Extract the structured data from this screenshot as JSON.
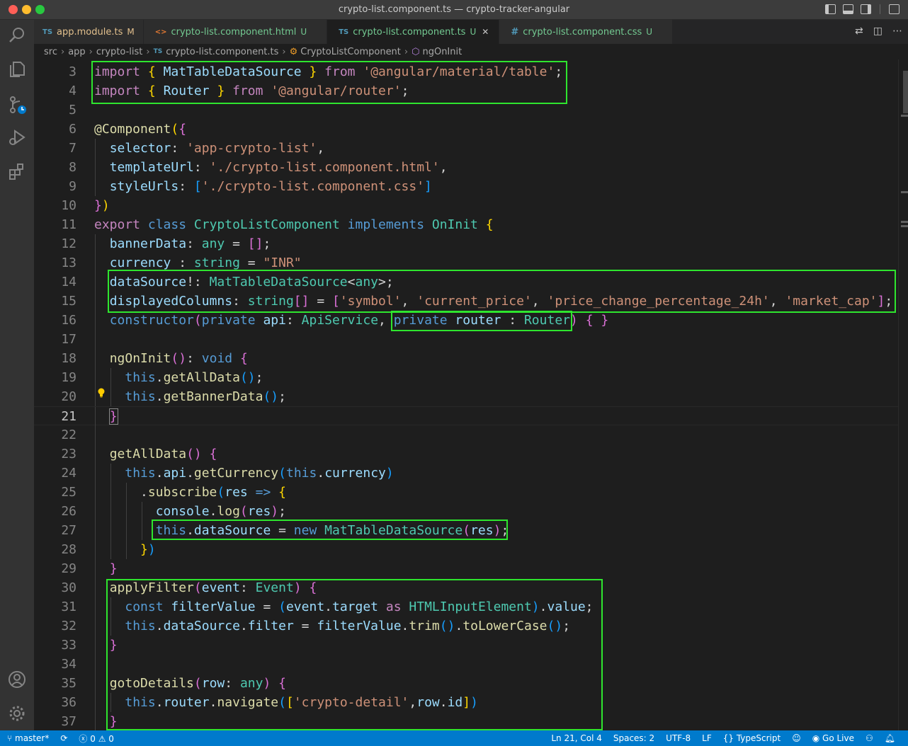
{
  "window": {
    "title": "crypto-list.component.ts — crypto-tracker-angular"
  },
  "activity_bar": [
    "files-icon",
    "search-icon",
    "source-control-icon",
    "run-debug-icon",
    "extensions-icon",
    "account-icon",
    "manage-gear-icon"
  ],
  "tabs": [
    {
      "badge": "TS",
      "label": "app.module.ts",
      "status": "M",
      "active": false
    },
    {
      "badge": "<>",
      "label": "crypto-list.component.html",
      "status": "U",
      "active": false
    },
    {
      "badge": "TS",
      "label": "crypto-list.component.ts",
      "status": "U",
      "active": true
    },
    {
      "badge": "#",
      "label": "crypto-list.component.css",
      "status": "U",
      "active": false
    }
  ],
  "breadcrumb": {
    "parts": [
      "src",
      "app",
      "crypto-list"
    ],
    "file_badge": "TS",
    "file": "crypto-list.component.ts",
    "class": "CryptoListComponent",
    "method": "ngOnInit"
  },
  "editor": {
    "current_line": 21,
    "line_numbers": [
      "3",
      "4",
      "5",
      "6",
      "7",
      "8",
      "9",
      "10",
      "11",
      "12",
      "13",
      "14",
      "15",
      "16",
      "17",
      "18",
      "19",
      "20",
      "21",
      "22",
      "23",
      "24",
      "25",
      "26",
      "27",
      "28",
      "29",
      "30",
      "31",
      "32",
      "33",
      "34",
      "35",
      "36",
      "37"
    ]
  },
  "statusbar": {
    "branch": "master*",
    "errors": "0",
    "warnings": "0",
    "position": "Ln 21, Col 4",
    "spaces": "Spaces: 2",
    "encoding": "UTF-8",
    "eol": "LF",
    "language": "TypeScript",
    "golive": "Go Live"
  }
}
